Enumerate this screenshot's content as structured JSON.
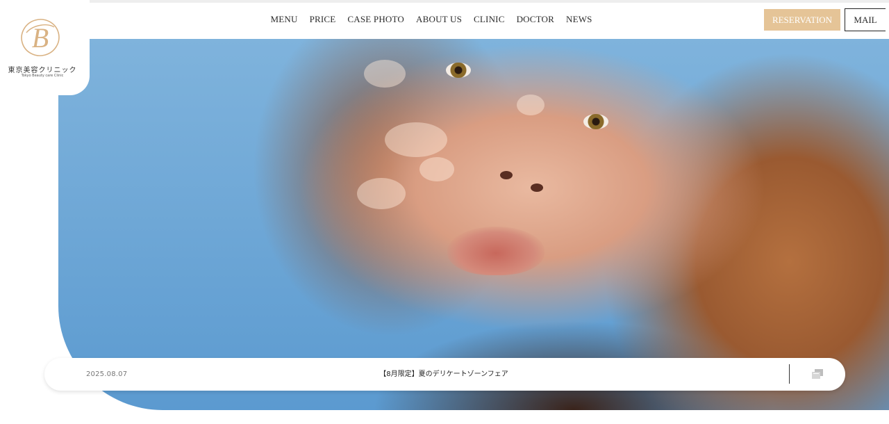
{
  "brand": {
    "logo_letter": "B",
    "name_jp": "東京美容クリニック",
    "name_en": "Tokyo Beauty care Clinic",
    "accent_color": "#e5c497"
  },
  "nav": {
    "items": [
      {
        "label": "MENU"
      },
      {
        "label": "PRICE"
      },
      {
        "label": "CASE PHOTO"
      },
      {
        "label": "ABOUT US"
      },
      {
        "label": "CLINIC"
      },
      {
        "label": "DOCTOR"
      },
      {
        "label": "NEWS"
      }
    ]
  },
  "header_buttons": {
    "reservation_label": "RESERVATION",
    "mail_label": "MAIL"
  },
  "news": {
    "date": "2025.08.07",
    "title": "【8月限定】夏のデリケートゾーンフェア",
    "list_icon": "news-list-icon"
  }
}
